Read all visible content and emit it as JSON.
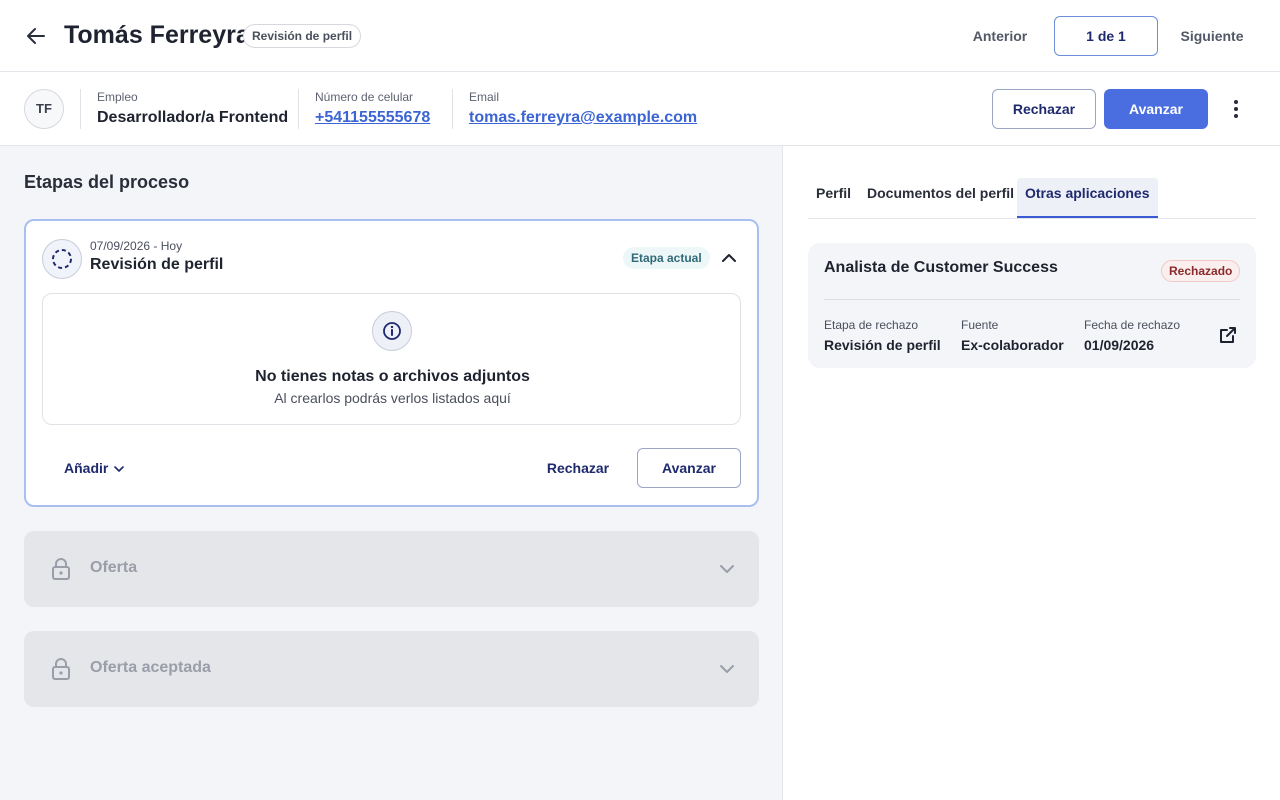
{
  "header": {
    "candidate_name": "Tomás Ferreyra",
    "stage_chip": "Revisión de perfil",
    "prev_label": "Anterior",
    "count_label": "1 de 1",
    "next_label": "Siguiente"
  },
  "info": {
    "avatar_initials": "TF",
    "job_label": "Empleo",
    "job_value": "Desarrollador/a Frontend",
    "phone_label": "Número de celular",
    "phone_value": "+541155555678",
    "email_label": "Email",
    "email_value": "tomas.ferreyra@example.com",
    "reject_label": "Rechazar",
    "advance_label": "Avanzar"
  },
  "process": {
    "title": "Etapas del proceso",
    "current_stage": {
      "date": "07/09/2026 - Hoy",
      "name": "Revisión de perfil",
      "badge": "Etapa actual",
      "empty_title": "No tienes notas o archivos adjuntos",
      "empty_subtitle": "Al crearlos podrás verlos listados aquí",
      "add_label": "Añadir",
      "reject_label": "Rechazar",
      "advance_label": "Avanzar"
    },
    "locked_stages": [
      {
        "name": "Oferta"
      },
      {
        "name": "Oferta aceptada"
      }
    ]
  },
  "tabs": [
    {
      "label": "Perfil",
      "active": false
    },
    {
      "label": "Documentos del perfil",
      "active": false
    },
    {
      "label": "Otras aplicaciones",
      "active": true
    }
  ],
  "applications": [
    {
      "title": "Analista de Customer Success",
      "status": "Rechazado",
      "fields": [
        {
          "label": "Etapa de rechazo",
          "value": "Revisión de perfil"
        },
        {
          "label": "Fuente",
          "value": "Ex-colaborador"
        },
        {
          "label": "Fecha de rechazo",
          "value": "01/09/2026"
        }
      ]
    }
  ],
  "colors": {
    "primary": "#4a6ee0",
    "link": "#3b64d4",
    "navy_text": "#1f2a6e",
    "rejected_text": "#8a2a2a"
  }
}
